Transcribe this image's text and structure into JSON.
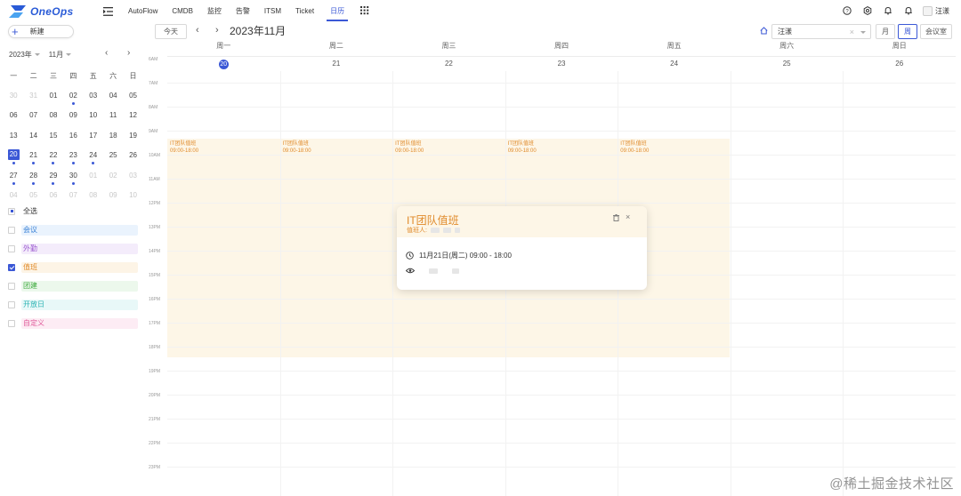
{
  "app": {
    "name": "OneOps",
    "brand_color": "#2a5bd7",
    "accent": "#3b58d6"
  },
  "nav": {
    "items": [
      {
        "label": "AutoFlow",
        "active": false
      },
      {
        "label": "CMDB",
        "active": false
      },
      {
        "label": "监控",
        "active": false
      },
      {
        "label": "告警",
        "active": false
      },
      {
        "label": "ITSM",
        "active": false
      },
      {
        "label": "Ticket",
        "active": false
      },
      {
        "label": "日历",
        "active": true
      }
    ]
  },
  "user": {
    "name": "汪漾"
  },
  "topbar_icons": [
    "help-icon",
    "settings-icon",
    "bell-icon",
    "notification-icon"
  ],
  "sidebar": {
    "new_button": "新建",
    "mini_calendar": {
      "year": "2023年",
      "month": "11月",
      "weekdays": [
        "一",
        "二",
        "三",
        "四",
        "五",
        "六",
        "日"
      ],
      "days": [
        {
          "d": "30",
          "dim": true
        },
        {
          "d": "31",
          "dim": true
        },
        {
          "d": "01"
        },
        {
          "d": "02",
          "dot": true
        },
        {
          "d": "03"
        },
        {
          "d": "04"
        },
        {
          "d": "05"
        },
        {
          "d": "06"
        },
        {
          "d": "07"
        },
        {
          "d": "08"
        },
        {
          "d": "09"
        },
        {
          "d": "10"
        },
        {
          "d": "11"
        },
        {
          "d": "12"
        },
        {
          "d": "13"
        },
        {
          "d": "14"
        },
        {
          "d": "15"
        },
        {
          "d": "16"
        },
        {
          "d": "17"
        },
        {
          "d": "18"
        },
        {
          "d": "19"
        },
        {
          "d": "20",
          "today": true,
          "dot": true
        },
        {
          "d": "21",
          "dot": true
        },
        {
          "d": "22",
          "dot": true
        },
        {
          "d": "23",
          "dot": true
        },
        {
          "d": "24",
          "dot": true
        },
        {
          "d": "25"
        },
        {
          "d": "26"
        },
        {
          "d": "27",
          "dot": true
        },
        {
          "d": "28",
          "dot": true
        },
        {
          "d": "29",
          "dot": true
        },
        {
          "d": "30",
          "dot": true
        },
        {
          "d": "01",
          "dim": true
        },
        {
          "d": "02",
          "dim": true
        },
        {
          "d": "03",
          "dim": true
        },
        {
          "d": "04",
          "dim": true
        },
        {
          "d": "05",
          "dim": true
        },
        {
          "d": "06",
          "dim": true
        },
        {
          "d": "07",
          "dim": true
        },
        {
          "d": "08",
          "dim": true
        },
        {
          "d": "09",
          "dim": true
        },
        {
          "d": "10",
          "dim": true
        }
      ]
    },
    "filters": [
      {
        "label": "全选",
        "state": "partial",
        "color": "#333333",
        "bg": "transparent"
      },
      {
        "label": "会议",
        "state": "unchecked",
        "color": "#3b82d6",
        "bg": "#eaf3fd"
      },
      {
        "label": "外勤",
        "state": "unchecked",
        "color": "#9b59d0",
        "bg": "#f4ecfb"
      },
      {
        "label": "值班",
        "state": "checked",
        "color": "#e08a2a",
        "bg": "#fdf4e6"
      },
      {
        "label": "团建",
        "state": "unchecked",
        "color": "#3caa3c",
        "bg": "#ecf8ec"
      },
      {
        "label": "开放日",
        "state": "unchecked",
        "color": "#2bb3b3",
        "bg": "#e8f8f8"
      },
      {
        "label": "自定义",
        "state": "unchecked",
        "color": "#e05a9a",
        "bg": "#fdecf4"
      }
    ]
  },
  "toolbar": {
    "today": "今天",
    "title": "2023年11月",
    "person": "汪漾",
    "views": [
      {
        "label": "月",
        "active": false
      },
      {
        "label": "周",
        "active": true
      },
      {
        "label": "会议室",
        "active": false
      }
    ]
  },
  "week": {
    "days": [
      {
        "dow": "周一",
        "date": "20",
        "today": true
      },
      {
        "dow": "周二",
        "date": "21"
      },
      {
        "dow": "周三",
        "date": "22"
      },
      {
        "dow": "周四",
        "date": "23"
      },
      {
        "dow": "周五",
        "date": "24"
      },
      {
        "dow": "周六",
        "date": "25"
      },
      {
        "dow": "周日",
        "date": "26"
      }
    ],
    "time_labels": [
      "6AM",
      "7AM",
      "8AM",
      "9AM",
      "10AM",
      "11AM",
      "12PM",
      "13PM",
      "14PM",
      "15PM",
      "16PM",
      "17PM",
      "18PM",
      "19PM",
      "20PM",
      "21PM",
      "22PM",
      "23PM"
    ],
    "events": [
      {
        "title": "IT团队值班",
        "time": "09:00-18:00"
      },
      {
        "title": "IT团队值班",
        "time": "09:00-18:00"
      },
      {
        "title": "IT团队值班",
        "time": "09:00-18:00"
      },
      {
        "title": "IT团队值班",
        "time": "09:00-18:00"
      },
      {
        "title": "IT团队值班",
        "time": "09:00-18:00"
      }
    ]
  },
  "popover": {
    "title": "IT团队值班",
    "duty_label": "值班人:",
    "datetime": "11月21日(周二) 09:00 - 18:00"
  },
  "watermark": "@稀土掘金技术社区"
}
